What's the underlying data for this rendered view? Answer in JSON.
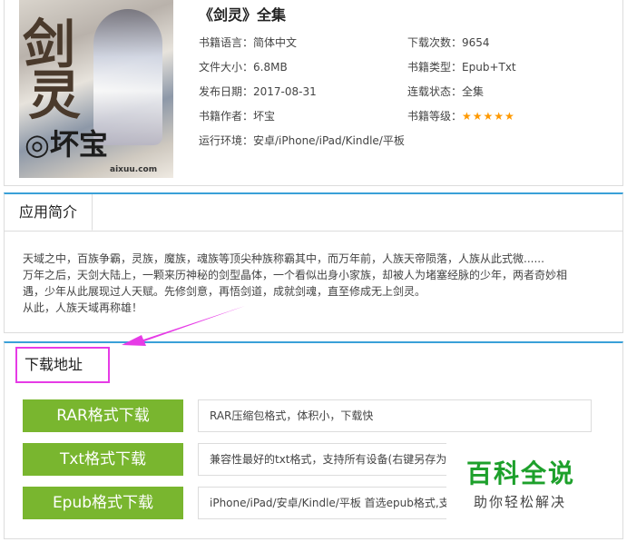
{
  "book": {
    "title": "《剑灵》全集",
    "cover": {
      "title_char1": "剑",
      "title_char2": "灵",
      "author_mark": "◎坏宝",
      "site": "aixuu.com"
    },
    "meta": [
      {
        "label": "书籍语言：",
        "value": "简体中文"
      },
      {
        "label": "下载次数：",
        "value": "9654"
      },
      {
        "label": "文件大小：",
        "value": "6.8MB"
      },
      {
        "label": "书籍类型：",
        "value": "Epub+Txt"
      },
      {
        "label": "发布日期：",
        "value": "2017-08-31"
      },
      {
        "label": "连载状态：",
        "value": "全集"
      },
      {
        "label": "书籍作者：",
        "value": "坏宝"
      },
      {
        "label": "书籍等级：",
        "value": "★★★★★"
      },
      {
        "label": "运行环境：",
        "value": "安卓/iPhone/iPad/Kindle/平板"
      }
    ],
    "rating": 5
  },
  "intro": {
    "tab": "应用简介",
    "lines": [
      "天域之中，百族争霸，灵族，魔族，魂族等顶尖种族称霸其中，而万年前，人族天帝陨落，人族从此式微......",
      "万年之后，天剑大陆上，一颗来历神秘的剑型晶体，一个看似出身小家族，却被人为堵塞经脉的少年，两者奇妙相",
      "遇，少年从此展现过人天赋。先修剑意，再悟剑道，成就剑魂，直至修成无上剑灵。",
      "从此，人族天域再称雄！"
    ]
  },
  "download": {
    "tab": "下载地址",
    "items": [
      {
        "button": "RAR格式下载",
        "desc": "RAR压缩包格式，体积小，下载快"
      },
      {
        "button": "Txt格式下载",
        "desc": "兼容性最好的txt格式，支持所有设备(右键另存为"
      },
      {
        "button": "Epub格式下载",
        "desc": "iPhone/iPad/安卓/Kindle/平板 首选epub格式,支"
      }
    ]
  },
  "watermark": {
    "title": "百科全说",
    "subtitle": "助你轻松解决"
  },
  "colors": {
    "accent": "#3aa0d8",
    "button": "#79b62f",
    "highlight": "#e63be6",
    "star": "#ff9900",
    "watermark": "#1da02b"
  }
}
